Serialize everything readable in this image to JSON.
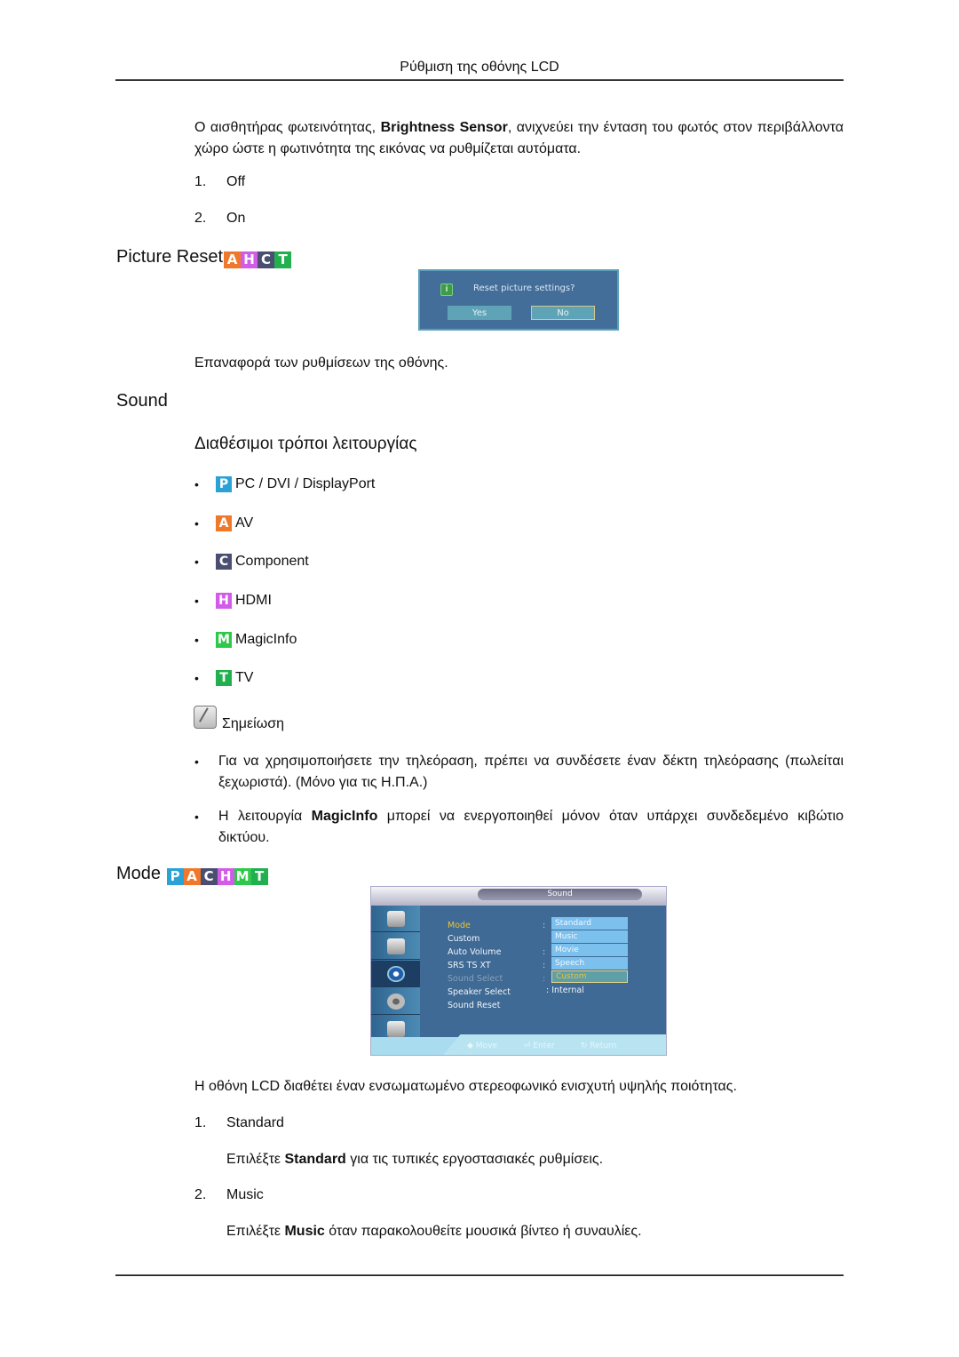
{
  "header": {
    "title": "Ρύθμιση της οθόνης LCD"
  },
  "brightness": {
    "intro_before": "Ο αισθητήρας φωτεινότητας, ",
    "intro_bold": "Brightness Sensor",
    "intro_after": ", ανιχνεύει την ένταση του φωτός στον περιβάλλοντα χώρο ώστε η φωτινότητα της εικόνας να ρυθμίζεται αυτόματα.",
    "options": [
      {
        "num": "1.",
        "label": "Off"
      },
      {
        "num": "2.",
        "label": "On"
      }
    ]
  },
  "picture_reset": {
    "heading": "Picture Reset",
    "badges": [
      {
        "letter": "A",
        "color": "#f0782a"
      },
      {
        "letter": "H",
        "color": "#d25be8"
      },
      {
        "letter": "C",
        "color": "#4a4f72"
      },
      {
        "letter": "T",
        "color": "#22b04f"
      }
    ],
    "dialog": {
      "message": "Reset picture settings?",
      "yes": "Yes",
      "no": "No",
      "selected": "No"
    },
    "description": "Επαναφορά των ρυθμίσεων της οθόνης."
  },
  "sound": {
    "heading": "Sound",
    "subheading": "Διαθέσιμοι τρόποι λειτουργίας",
    "sources": [
      {
        "badge": "P",
        "color": "#2aa2d6",
        "label": "PC / DVI / DisplayPort"
      },
      {
        "badge": "A",
        "color": "#f0782a",
        "label": "AV"
      },
      {
        "badge": "C",
        "color": "#4a4f72",
        "label": "Component"
      },
      {
        "badge": "H",
        "color": "#d25be8",
        "label": "HDMI"
      },
      {
        "badge": "M",
        "color": "#2ec94a",
        "label": "MagicInfo"
      },
      {
        "badge": "T",
        "color": "#22b04f",
        "label": "TV"
      }
    ],
    "note_label": "Σημείωση",
    "notes": [
      {
        "text": "Για να χρησιμοποιήσετε την τηλεόραση, πρέπει να συνδέσετε έναν δέκτη τηλεόρασης (πωλείται ξεχωριστά). (Μόνο για τις Η.Π.Α.)"
      },
      {
        "before": "Η λειτουργία ",
        "bold": "MagicInfo",
        "after": " μπορεί να ενεργοποιηθεί μόνον όταν υπάρχει συνδεδεμένο κιβώτιο δικτύου."
      }
    ]
  },
  "mode": {
    "heading": "Mode",
    "badges": [
      {
        "letter": "P",
        "color": "#2aa2d6"
      },
      {
        "letter": "A",
        "color": "#f0782a"
      },
      {
        "letter": "C",
        "color": "#4a4f72"
      },
      {
        "letter": "H",
        "color": "#d25be8"
      },
      {
        "letter": "M",
        "color": "#2ec94a"
      },
      {
        "letter": "T",
        "color": "#22b04f"
      }
    ],
    "osd": {
      "title": "Sound",
      "sidebar_icons": [
        "input-icon",
        "picture-icon",
        "sound-icon",
        "setup-icon",
        "multi-control-icon"
      ],
      "active_sidebar": "sound-icon",
      "menu_items": [
        "Mode",
        "Custom",
        "Auto Volume",
        "SRS TS XT",
        "Sound Select",
        "Speaker Select",
        "Sound Reset"
      ],
      "selected_item": "Mode",
      "disabled_item": "Sound Select",
      "dropdown_options": [
        "Standard",
        "Music",
        "Movie",
        "Speech",
        "Custom"
      ],
      "dropdown_highlight": "Custom",
      "speaker_select_value": ": Internal",
      "nav": {
        "move": "Move",
        "enter": "Enter",
        "return": "Return"
      }
    },
    "description": "Η οθόνη LCD διαθέτει έναν ενσωματωμένο στερεοφωνικό ενισχυτή υψηλής ποιότητας.",
    "items": [
      {
        "num": "1.",
        "label": "Standard",
        "desc_before": "Επιλέξτε ",
        "desc_bold": "Standard",
        "desc_after": " για τις τυπικές εργοστασιακές ρυθμίσεις."
      },
      {
        "num": "2.",
        "label": "Music",
        "desc_before": "Επιλέξτε ",
        "desc_bold": "Music",
        "desc_after": " όταν παρακολουθείτε μουσικά βίντεο ή συναυλίες."
      }
    ]
  }
}
